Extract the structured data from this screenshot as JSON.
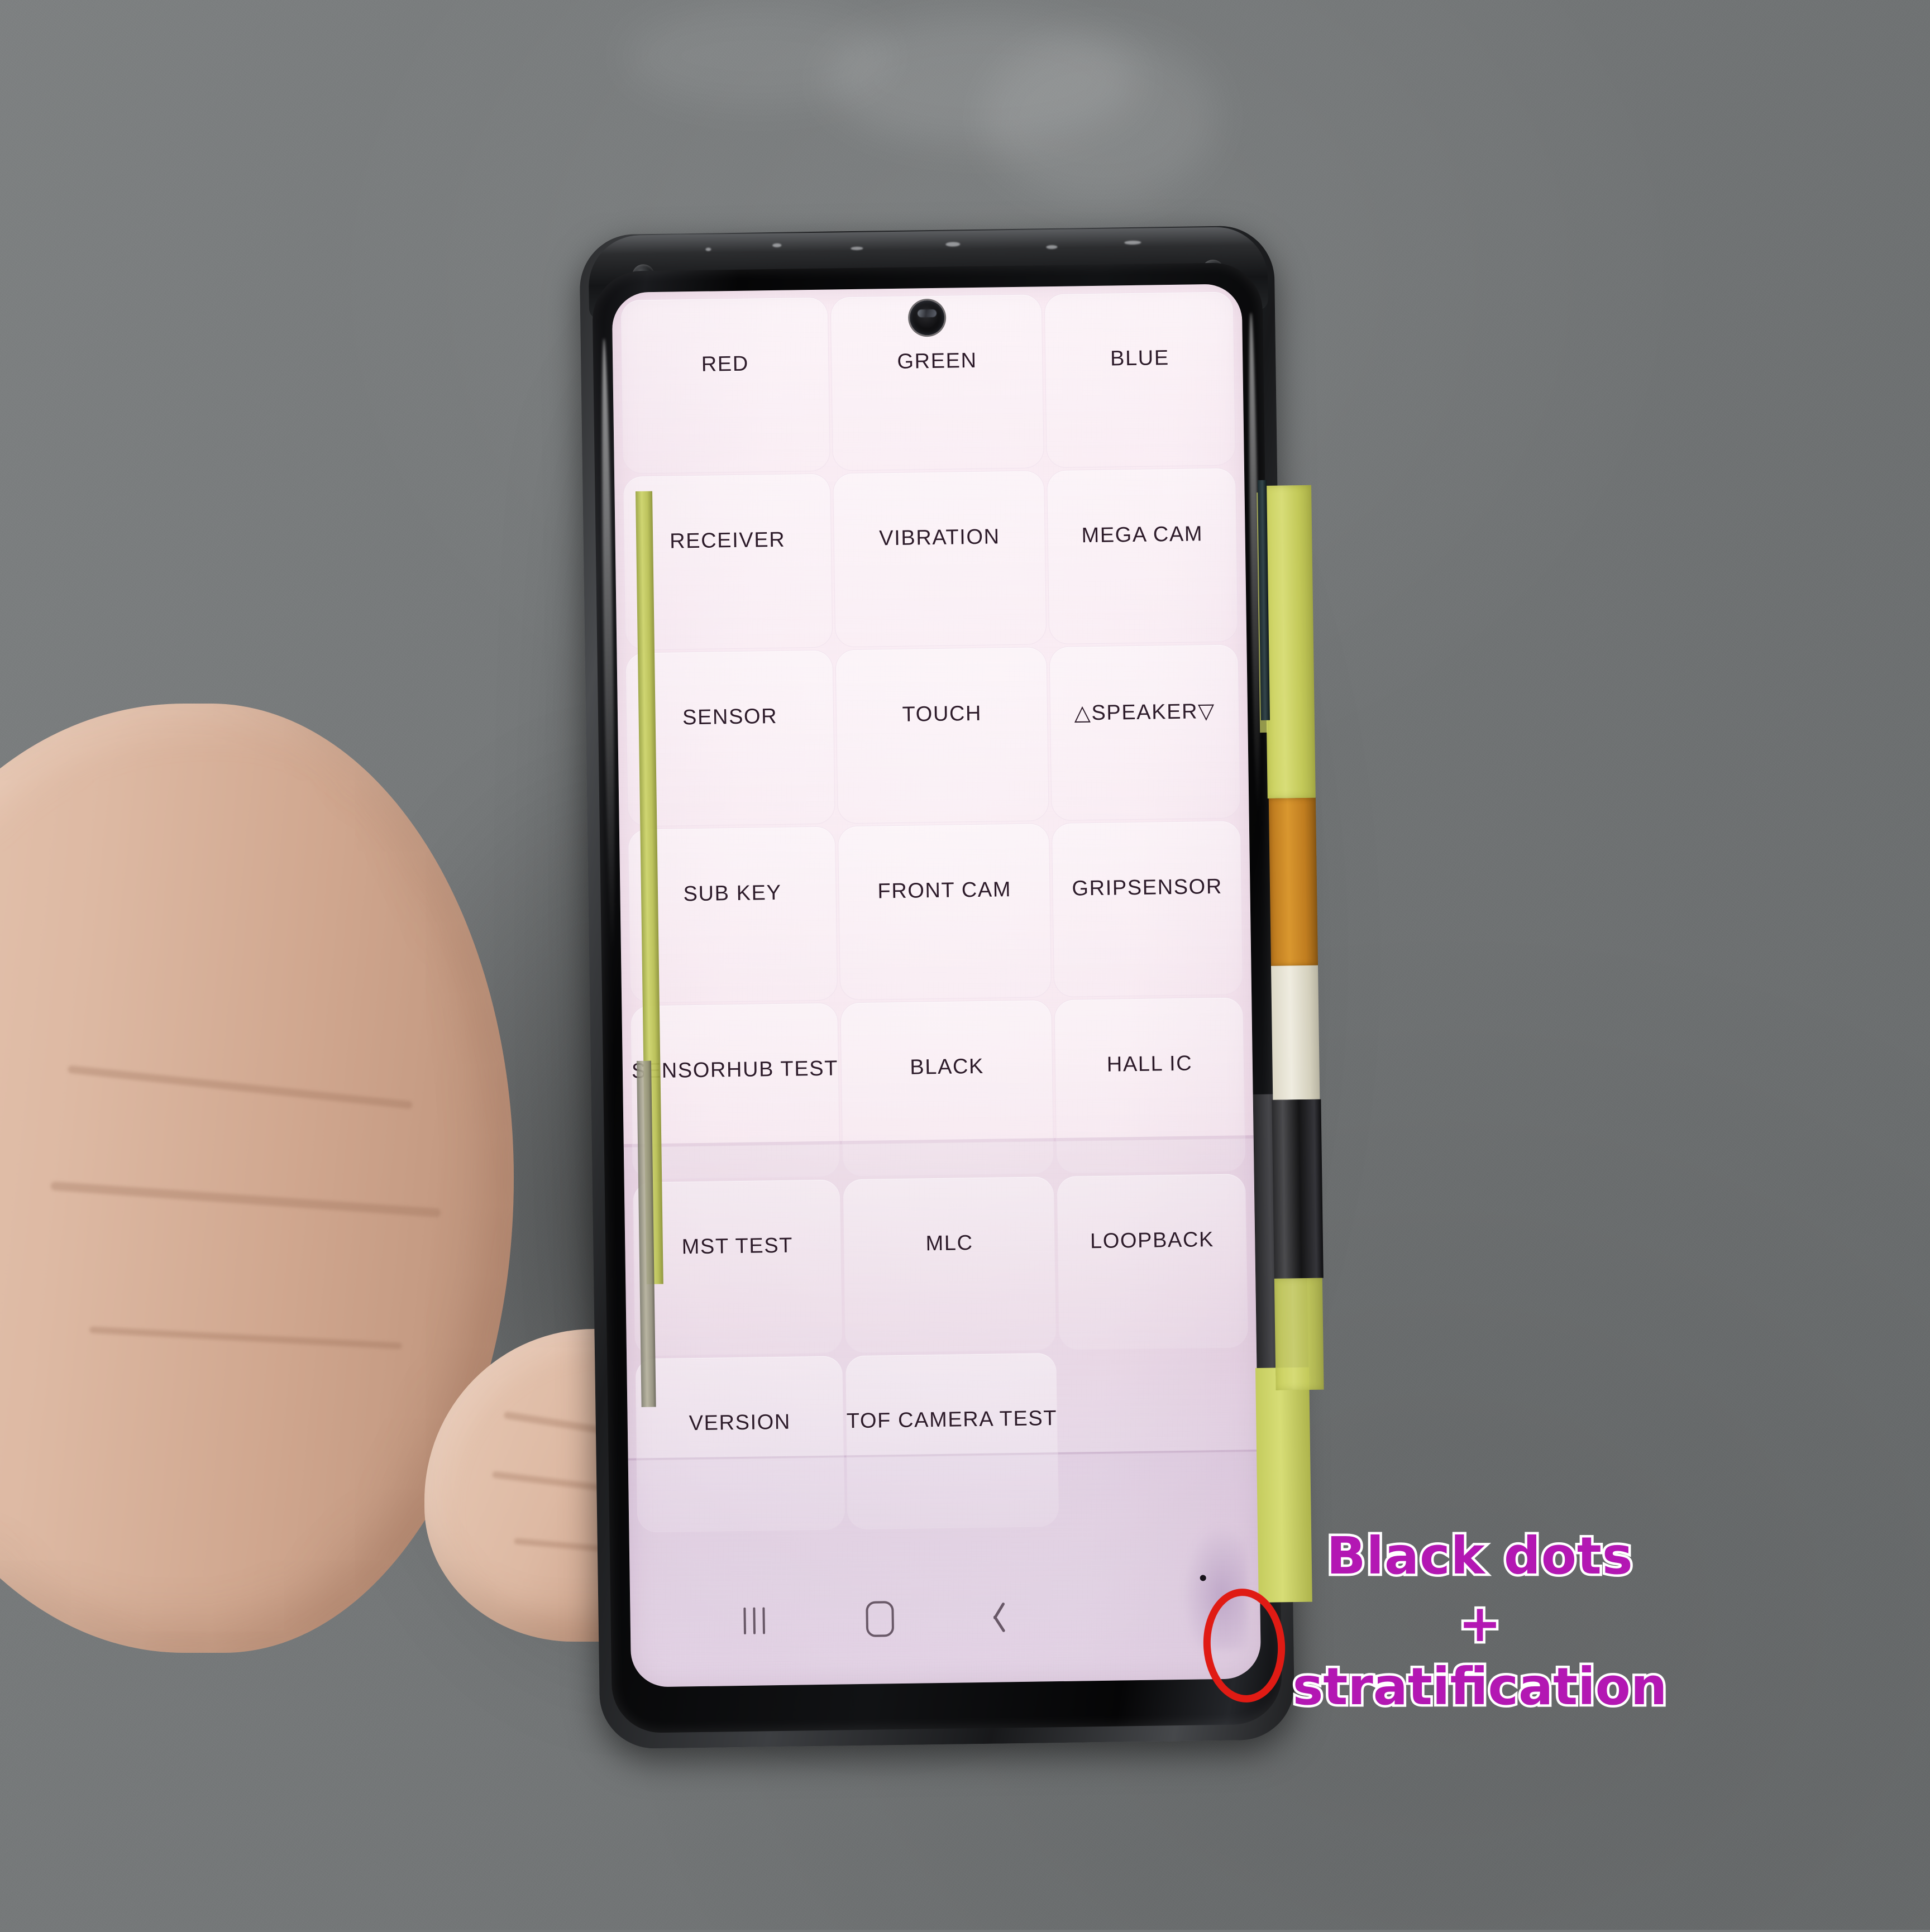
{
  "scene": {
    "description": "Hand holding a disassembled Samsung Galaxy phone showing the *#0*# hardware diagnostic test menu on a pink-tinted defective OLED panel",
    "wall_color": "#76797a",
    "frame_color": "#1a1b1e",
    "skin_color": "#dcb9a3"
  },
  "screen": {
    "background_color": "#f8e9f1",
    "tile_border_color": "#ecdcea",
    "label_color": "#2d1b2a",
    "grid_columns": 3,
    "buttons": [
      "RED",
      "GREEN",
      "BLUE",
      "RECEIVER",
      "VIBRATION",
      "MEGA CAM",
      "SENSOR",
      "TOUCH",
      "△SPEAKER▽",
      "SUB KEY",
      "FRONT CAM",
      "GRIPSENSOR",
      "SENSORHUB TEST",
      "BLACK",
      "HALL IC",
      "MST TEST",
      "MLC",
      "LOOPBACK",
      "VERSION",
      "TOF CAMERA TEST",
      ""
    ]
  },
  "navbar": {
    "recents_label": "recents-icon",
    "home_label": "home-icon",
    "back_label": "back-icon"
  },
  "defects": {
    "black_dot_color": "#17121a",
    "stratification_band_color": "#e9dcea"
  },
  "annotation": {
    "line1": "Black dots",
    "plus": "+",
    "line2": "stratification",
    "text_color": "#b317b3",
    "outline_color": "#ffffff",
    "marker_color": "#e01b14",
    "marker_shape": "ellipse"
  },
  "hardware": {
    "tape_color": "#cdd46b",
    "flex_cable_color": "#c07d20",
    "flex_white_color": "#e5e1d3"
  }
}
